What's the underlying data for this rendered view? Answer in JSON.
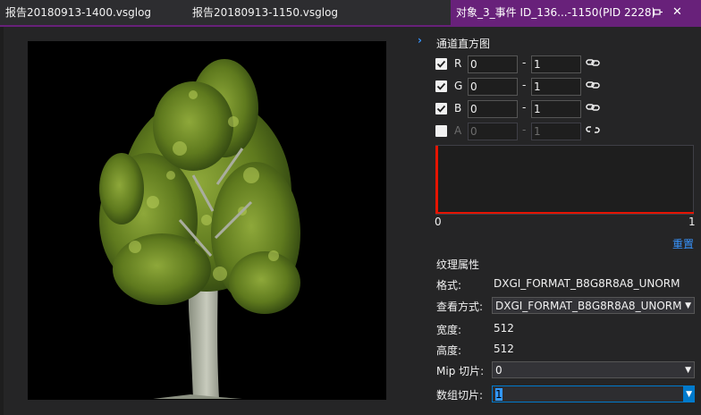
{
  "tabs": [
    {
      "label": "报告20180913-1400.vsglog"
    },
    {
      "label": "报告20180913-1150.vsglog"
    },
    {
      "label": "对象_3_事件 ID_136...-1150(PID 2228)"
    }
  ],
  "colors": {
    "accent": "#68217a",
    "link": "#3794ff",
    "histogram": "#e51400"
  },
  "icons": {
    "pin": "pin-icon",
    "close": "close-icon",
    "link": "chain-link-icon",
    "unlink": "broken-link-icon",
    "chevron": "chevron-right-icon",
    "dropdown": "chevron-down-icon"
  },
  "channels": {
    "title": "通道直方图",
    "items": [
      {
        "label": "R",
        "checked": true,
        "min": "0",
        "max": "1"
      },
      {
        "label": "G",
        "checked": true,
        "min": "0",
        "max": "1"
      },
      {
        "label": "B",
        "checked": true,
        "min": "0",
        "max": "1"
      },
      {
        "label": "A",
        "checked": false,
        "min": "0",
        "max": "1"
      }
    ],
    "separator": "-"
  },
  "histogram": {
    "axis_min": "0",
    "axis_max": "1",
    "reset": "重置"
  },
  "properties": {
    "title": "纹理属性",
    "format_label": "格式:",
    "format_value": "DXGI_FORMAT_B8G8R8A8_UNORM",
    "view_label": "查看方式:",
    "view_value": "DXGI_FORMAT_B8G8R8A8_UNORM",
    "width_label": "宽度:",
    "width_value": "512",
    "height_label": "高度:",
    "height_value": "512",
    "mip_label": "Mip 切片:",
    "mip_value": "0",
    "array_label": "数组切片:",
    "array_value": "1"
  }
}
